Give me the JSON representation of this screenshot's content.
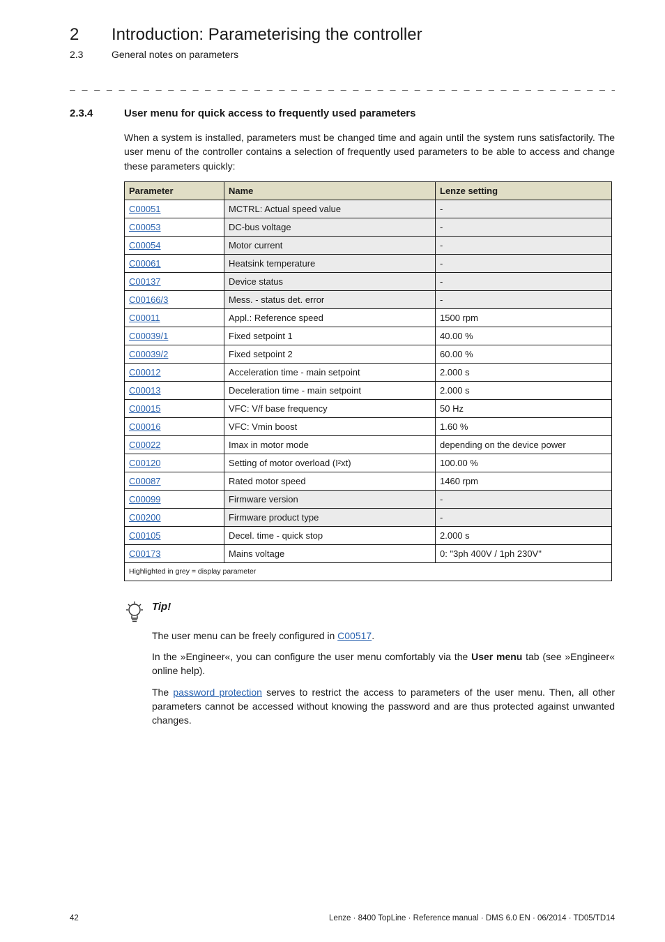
{
  "header": {
    "chapter_num": "2",
    "chapter_title": "Introduction: Parameterising the controller",
    "sub_num": "2.3",
    "sub_title": "General notes on parameters"
  },
  "section": {
    "num": "2.3.4",
    "title": "User menu for quick access to frequently used parameters",
    "intro": "When a system is installed, parameters must be changed time and again until the system runs satisfactorily. The user menu of the controller contains a selection of frequently used parameters to be able to access and change these parameters quickly:"
  },
  "table": {
    "headers": [
      "Parameter",
      "Name",
      "Lenze setting"
    ],
    "rows": [
      {
        "param": "C00051",
        "name": "MCTRL: Actual speed value",
        "setting": "-",
        "grey": true
      },
      {
        "param": "C00053",
        "name": "DC-bus voltage",
        "setting": "-",
        "grey": true
      },
      {
        "param": "C00054",
        "name": "Motor current",
        "setting": "-",
        "grey": true
      },
      {
        "param": "C00061",
        "name": "Heatsink temperature",
        "setting": "-",
        "grey": true
      },
      {
        "param": "C00137",
        "name": "Device status",
        "setting": "-",
        "grey": true
      },
      {
        "param": "C00166/3",
        "name": "Mess. - status det. error",
        "setting": "-",
        "grey": true
      },
      {
        "param": "C00011",
        "name": "Appl.: Reference speed",
        "setting": "1500 rpm",
        "grey": false
      },
      {
        "param": "C00039/1",
        "name": "Fixed setpoint 1",
        "setting": "40.00 %",
        "grey": false
      },
      {
        "param": "C00039/2",
        "name": "Fixed setpoint 2",
        "setting": "60.00 %",
        "grey": false
      },
      {
        "param": "C00012",
        "name": "Acceleration time - main setpoint",
        "setting": "2.000 s",
        "grey": false
      },
      {
        "param": "C00013",
        "name": "Deceleration time - main setpoint",
        "setting": "2.000 s",
        "grey": false
      },
      {
        "param": "C00015",
        "name": "VFC: V/f base frequency",
        "setting": "50 Hz",
        "grey": false
      },
      {
        "param": "C00016",
        "name": "VFC: Vmin boost",
        "setting": "1.60 %",
        "grey": false
      },
      {
        "param": "C00022",
        "name": "Imax in motor mode",
        "setting": "depending on the device power",
        "grey": false
      },
      {
        "param": "C00120",
        "name": "Setting of motor overload (I²xt)",
        "setting": "100.00 %",
        "grey": false
      },
      {
        "param": "C00087",
        "name": "Rated motor speed",
        "setting": "1460 rpm",
        "grey": false
      },
      {
        "param": "C00099",
        "name": "Firmware version",
        "setting": "-",
        "grey": true
      },
      {
        "param": "C00200",
        "name": "Firmware product type",
        "setting": "-",
        "grey": true
      },
      {
        "param": "C00105",
        "name": "Decel. time - quick stop",
        "setting": "2.000 s",
        "grey": false
      },
      {
        "param": "C00173",
        "name": "Mains voltage",
        "setting": "0: \"3ph 400V / 1ph 230V\"",
        "grey": false
      }
    ],
    "footnote": "Highlighted in grey = display parameter"
  },
  "tip": {
    "heading": "Tip!",
    "p1_pre": "The user menu can be freely configured in ",
    "p1_link": "C00517",
    "p1_post": ".",
    "p2_pre": "In the »Engineer«, you can configure the user menu comfortably via the ",
    "p2_bold": "User menu",
    "p2_post": " tab (see »Engineer« online help).",
    "p3_pre": "The ",
    "p3_link": "password protection",
    "p3_post": " serves to restrict the access to parameters of the user menu. Then, all other parameters cannot be accessed without knowing the password and are thus protected against unwanted changes."
  },
  "footer": {
    "page": "42",
    "info": "Lenze · 8400 TopLine · Reference manual · DMS 6.0 EN · 06/2014 · TD05/TD14"
  }
}
